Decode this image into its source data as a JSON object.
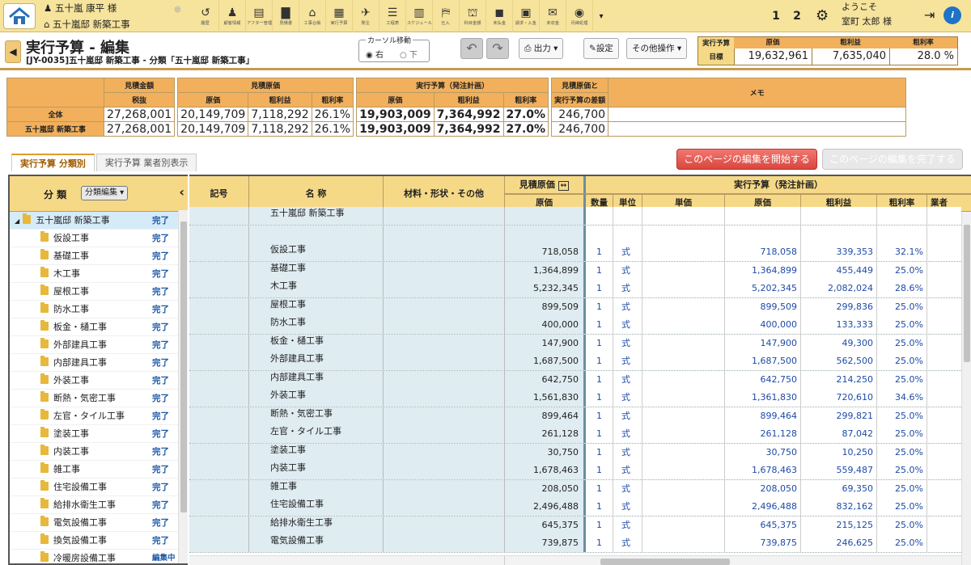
{
  "header": {
    "customer_name": "五十嵐 康平 様",
    "project_name": "五十嵐邸 新築工事",
    "toolbar": [
      {
        "label": "履歴",
        "icon": "history-icon",
        "glyph": "↺"
      },
      {
        "label": "顧客情報",
        "icon": "customer-icon",
        "glyph": "♟"
      },
      {
        "label": "アフター管理",
        "icon": "after-service-icon",
        "glyph": "▤"
      },
      {
        "label": "見積書",
        "icon": "estimate-icon",
        "glyph": "▇"
      },
      {
        "label": "工事台帳",
        "icon": "ledger-icon",
        "glyph": "⌂"
      },
      {
        "label": "実行予算",
        "icon": "budget-icon",
        "glyph": "▦"
      },
      {
        "label": "発注",
        "icon": "order-icon",
        "glyph": "✈"
      },
      {
        "label": "工程表",
        "icon": "schedule-chart-icon",
        "glyph": "☰"
      },
      {
        "label": "スケジュール",
        "icon": "calendar-icon",
        "glyph": "▥"
      },
      {
        "label": "仕入",
        "icon": "purchase-icon",
        "glyph": "⛿"
      },
      {
        "label": "科目金額",
        "icon": "account-icon",
        "glyph": "⛫"
      },
      {
        "label": "未払金",
        "icon": "payable-icon",
        "glyph": "◼"
      },
      {
        "label": "請求・入金",
        "icon": "invoice-icon",
        "glyph": "▣"
      },
      {
        "label": "未収金",
        "icon": "receivable-icon",
        "glyph": "✉"
      },
      {
        "label": "月締処理",
        "icon": "monthly-close-icon",
        "glyph": "◉"
      }
    ],
    "pages": [
      "1",
      "2"
    ],
    "welcome": "ようこそ",
    "user": "室町 太郎 様"
  },
  "page": {
    "title": "実行予算 - 編集",
    "subtitle": "[JY-0035]五十嵐邸 新築工事 - 分類「五十嵐邸 新築工事」",
    "cursor_label": "カーソル移動",
    "cursor_right": "右",
    "cursor_down": "下",
    "output_button": "出力",
    "settings_button": "設定",
    "other_button": "その他操作"
  },
  "target": {
    "label1": "実行予算",
    "label2": "目標",
    "cost_header": "原価",
    "profit_header": "粗利益",
    "rate_header": "粗利率",
    "cost": "19,632,961",
    "profit": "7,635,040",
    "rate": "28.0 %"
  },
  "summary": {
    "h_estimate": "見積金額",
    "h_tax": "税抜",
    "h_est_cost": "見積原価",
    "h_cost": "原価",
    "h_profit": "粗利益",
    "h_rate": "粗利率",
    "h_budget": "実行予算（発注計画）",
    "h_diff1": "見積原価と",
    "h_diff2": "実行予算の差額",
    "h_memo": "メモ",
    "rows": [
      {
        "label": "全体",
        "est": "27,268,001",
        "ecost": "20,149,709",
        "eprofit": "7,118,292",
        "erate": "26.1%",
        "bcost": "19,903,009",
        "bprofit": "7,364,992",
        "brate": "27.0%",
        "diff": "246,700"
      },
      {
        "label": "五十嵐邸 新築工事",
        "est": "27,268,001",
        "ecost": "20,149,709",
        "eprofit": "7,118,292",
        "erate": "26.1%",
        "bcost": "19,903,009",
        "bprofit": "7,364,992",
        "brate": "27.0%",
        "diff": "246,700"
      }
    ]
  },
  "tabs": [
    "実行予算 分類別",
    "実行予算 業者別表示"
  ],
  "edit_start": "このページの編集を開始する",
  "edit_end": "このページの編集を完了する",
  "categories": {
    "header": "分 類",
    "edit_button": "分類編集",
    "items": [
      {
        "name": "五十嵐邸 新築工事",
        "status": "完了"
      },
      {
        "name": "仮設工事",
        "status": "完了"
      },
      {
        "name": "基礎工事",
        "status": "完了"
      },
      {
        "name": "木工事",
        "status": "完了"
      },
      {
        "name": "屋根工事",
        "status": "完了"
      },
      {
        "name": "防水工事",
        "status": "完了"
      },
      {
        "name": "板金・樋工事",
        "status": "完了"
      },
      {
        "name": "外部建具工事",
        "status": "完了"
      },
      {
        "name": "内部建具工事",
        "status": "完了"
      },
      {
        "name": "外装工事",
        "status": "完了"
      },
      {
        "name": "断熱・気密工事",
        "status": "完了"
      },
      {
        "name": "左官・タイル工事",
        "status": "完了"
      },
      {
        "name": "塗装工事",
        "status": "完了"
      },
      {
        "name": "内装工事",
        "status": "完了"
      },
      {
        "name": "雑工事",
        "status": "完了"
      },
      {
        "name": "住宅設備工事",
        "status": "完了"
      },
      {
        "name": "給排水衛生工事",
        "status": "完了"
      },
      {
        "name": "電気設備工事",
        "status": "完了"
      },
      {
        "name": "換気設備工事",
        "status": "完了"
      },
      {
        "name": "冷暖房設備工事",
        "status": "編集中"
      }
    ]
  },
  "grid": {
    "h_mark": "記号",
    "h_name": "名 称",
    "h_material": "材料・形状・その他",
    "h_est_cost": "見積原価",
    "h_cost": "原価",
    "h_budget": "実行予算（発注計画）",
    "h_qty": "数量",
    "h_unit": "単位",
    "h_unit_price": "単価",
    "h_bcost": "原価",
    "h_bprofit": "粗利益",
    "h_brate": "粗利率",
    "h_vendor": "業者",
    "top_label": "五十嵐邸 新築工事",
    "rows": [
      {
        "name": "仮設工事",
        "ecost": "718,058",
        "qty": "1",
        "unit": "式",
        "cost": "718,058",
        "profit": "339,353",
        "rate": "32.1%"
      },
      {
        "name": "基礎工事",
        "ecost": "1,364,899",
        "qty": "1",
        "unit": "式",
        "cost": "1,364,899",
        "profit": "455,449",
        "rate": "25.0%"
      },
      {
        "name": "木工事",
        "ecost": "5,232,345",
        "qty": "1",
        "unit": "式",
        "cost": "5,202,345",
        "profit": "2,082,024",
        "rate": "28.6%"
      },
      {
        "name": "屋根工事",
        "ecost": "899,509",
        "qty": "1",
        "unit": "式",
        "cost": "899,509",
        "profit": "299,836",
        "rate": "25.0%"
      },
      {
        "name": "防水工事",
        "ecost": "400,000",
        "qty": "1",
        "unit": "式",
        "cost": "400,000",
        "profit": "133,333",
        "rate": "25.0%"
      },
      {
        "name": "板金・樋工事",
        "ecost": "147,900",
        "qty": "1",
        "unit": "式",
        "cost": "147,900",
        "profit": "49,300",
        "rate": "25.0%"
      },
      {
        "name": "外部建具工事",
        "ecost": "1,687,500",
        "qty": "1",
        "unit": "式",
        "cost": "1,687,500",
        "profit": "562,500",
        "rate": "25.0%"
      },
      {
        "name": "内部建具工事",
        "ecost": "642,750",
        "qty": "1",
        "unit": "式",
        "cost": "642,750",
        "profit": "214,250",
        "rate": "25.0%"
      },
      {
        "name": "外装工事",
        "ecost": "1,561,830",
        "qty": "1",
        "unit": "式",
        "cost": "1,361,830",
        "profit": "720,610",
        "rate": "34.6%"
      },
      {
        "name": "断熱・気密工事",
        "ecost": "899,464",
        "qty": "1",
        "unit": "式",
        "cost": "899,464",
        "profit": "299,821",
        "rate": "25.0%"
      },
      {
        "name": "左官・タイル工事",
        "ecost": "261,128",
        "qty": "1",
        "unit": "式",
        "cost": "261,128",
        "profit": "87,042",
        "rate": "25.0%"
      },
      {
        "name": "塗装工事",
        "ecost": "30,750",
        "qty": "1",
        "unit": "式",
        "cost": "30,750",
        "profit": "10,250",
        "rate": "25.0%"
      },
      {
        "name": "内装工事",
        "ecost": "1,678,463",
        "qty": "1",
        "unit": "式",
        "cost": "1,678,463",
        "profit": "559,487",
        "rate": "25.0%"
      },
      {
        "name": "雑工事",
        "ecost": "208,050",
        "qty": "1",
        "unit": "式",
        "cost": "208,050",
        "profit": "69,350",
        "rate": "25.0%"
      },
      {
        "name": "住宅設備工事",
        "ecost": "2,496,488",
        "qty": "1",
        "unit": "式",
        "cost": "2,496,488",
        "profit": "832,162",
        "rate": "25.0%"
      },
      {
        "name": "給排水衛生工事",
        "ecost": "645,375",
        "qty": "1",
        "unit": "式",
        "cost": "645,375",
        "profit": "215,125",
        "rate": "25.0%"
      },
      {
        "name": "電気設備工事",
        "ecost": "739,875",
        "qty": "1",
        "unit": "式",
        "cost": "739,875",
        "profit": "246,625",
        "rate": "25.0%"
      }
    ]
  }
}
